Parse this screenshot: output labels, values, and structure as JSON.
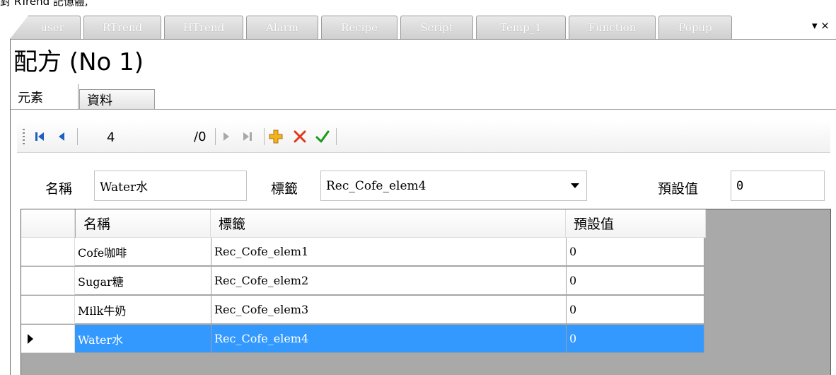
{
  "top_cut_text": "對 RTrend 記憶體,",
  "doc_tabs": [
    "user",
    "RTrend",
    "HTrend",
    "Alarm",
    "Recipe",
    "Script",
    "Temp_1",
    "Function",
    "Popup"
  ],
  "window_menu": "▾ ×",
  "page_title": "配方 (No 1)",
  "inner_tabs": {
    "active": "元素",
    "inactive": "資料"
  },
  "toolbar": {
    "position_value": "4",
    "count_label": "/0",
    "icons": [
      "move-first-icon",
      "move-previous-icon",
      "move-next-icon",
      "move-last-icon",
      "add-icon",
      "delete-icon",
      "confirm-icon"
    ],
    "colors": {
      "add": "#e8a317",
      "delete": "#e03a1c",
      "confirm": "#1a9a1a"
    }
  },
  "fields": {
    "name_label": "名稱",
    "name_value": "Water水",
    "tag_label": "標籤",
    "tag_value": "Rec_Cofe_elem4",
    "default_label": "預設值",
    "default_value": "0"
  },
  "grid": {
    "columns": [
      "名稱",
      "標籤",
      "預設值"
    ],
    "rows": [
      {
        "name": "Cofe咖啡",
        "tag": "Rec_Cofe_elem1",
        "default": "0"
      },
      {
        "name": "Sugar糖",
        "tag": "Rec_Cofe_elem2",
        "default": "0"
      },
      {
        "name": "Milk牛奶",
        "tag": "Rec_Cofe_elem3",
        "default": "0"
      },
      {
        "name": "Water水",
        "tag": "Rec_Cofe_elem4",
        "default": "0"
      }
    ],
    "selected_row": 3,
    "selection_color": "#3399ff"
  }
}
